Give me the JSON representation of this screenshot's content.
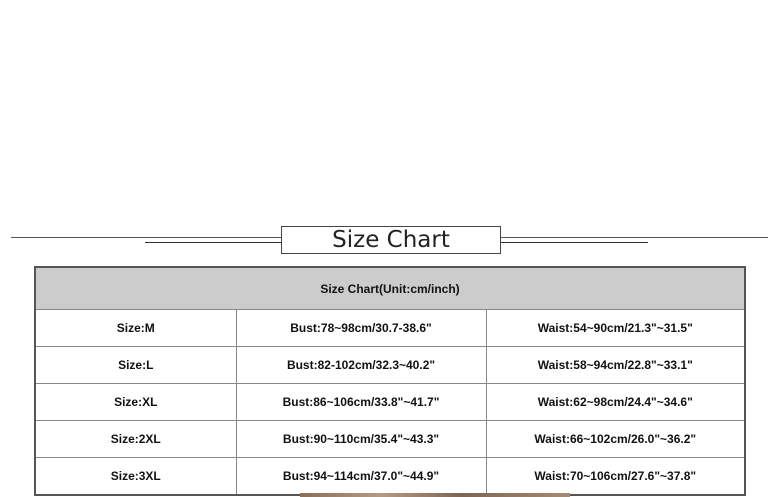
{
  "banner": {
    "title": "Size Chart"
  },
  "table": {
    "header": "Size Chart(Unit:cm/inch)",
    "rows": [
      {
        "size": "Size:M",
        "bust": "Bust:78~98cm/30.7-38.6\"",
        "waist": "Waist:54~90cm/21.3\"~31.5\""
      },
      {
        "size": "Size:L",
        "bust": "Bust:82-102cm/32.3~40.2\"",
        "waist": "Waist:58~94cm/22.8\"~33.1\""
      },
      {
        "size": "Size:XL",
        "bust": "Bust:86~106cm/33.8\"~41.7\"",
        "waist": "Waist:62~98cm/24.4\"~34.6\""
      },
      {
        "size": "Size:2XL",
        "bust": "Bust:90~110cm/35.4\"~43.3\"",
        "waist": "Waist:66~102cm/26.0\"~36.2\""
      },
      {
        "size": "Size:3XL",
        "bust": "Bust:94~114cm/37.0\"~44.9\"",
        "waist": "Waist:70~106cm/27.6\"~37.8\""
      }
    ]
  }
}
